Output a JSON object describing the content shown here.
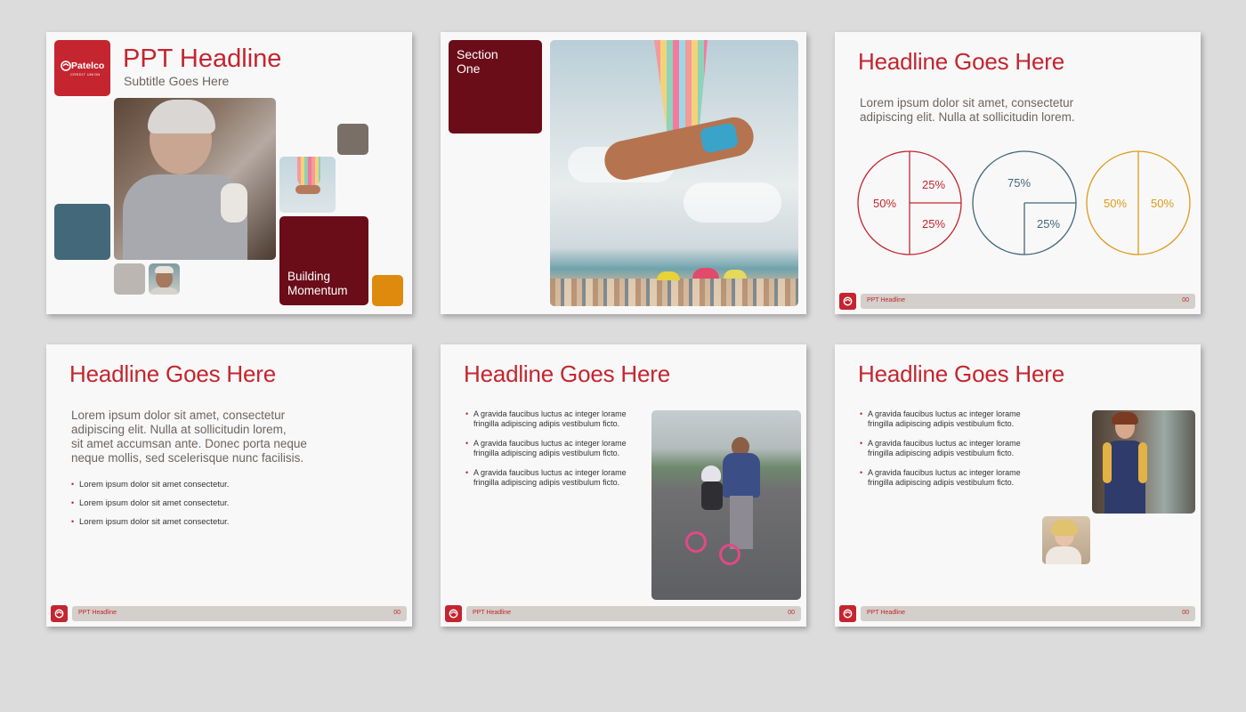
{
  "colors": {
    "brand_red": "#c4252f",
    "maroon": "#6a0d19",
    "slate_blue": "#42687a",
    "taupe": "#7a6f66",
    "light_gray": "#bbb6b1",
    "orange": "#dd8a0d",
    "footer_gray": "#d3cfca"
  },
  "slide1": {
    "logo_name": "Patelco",
    "logo_tagline": "CREDIT UNION",
    "title": "PPT Headline",
    "subtitle": "Subtitle Goes Here",
    "tile_text_1": "Building",
    "tile_text_2": "Momentum"
  },
  "slide2": {
    "section_line1": "Section",
    "section_line2": "One"
  },
  "slide3": {
    "headline": "Headline Goes Here",
    "body_line1": "Lorem ipsum dolor sit amet, consectetur",
    "body_line2": "adipiscing elit. Nulla at sollicitudin lorem.",
    "footer_label": "PPT Headline",
    "footer_page": "00"
  },
  "chart_data": {
    "type": "pie",
    "charts": [
      {
        "color": "#c4252f",
        "slices": [
          50,
          25,
          25
        ],
        "labels": [
          "50%",
          "25%",
          "25%"
        ]
      },
      {
        "color": "#42687a",
        "slices": [
          75,
          25
        ],
        "labels": [
          "75%",
          "25%"
        ]
      },
      {
        "color": "#dd9b1a",
        "slices": [
          50,
          50
        ],
        "labels": [
          "50%",
          "50%"
        ]
      }
    ]
  },
  "slide4": {
    "headline": "Headline Goes Here",
    "body_line1": "Lorem ipsum dolor sit amet, consectetur",
    "body_line2": "adipiscing elit. Nulla at sollicitudin lorem,",
    "body_line3": "sit amet accumsan ante. Donec porta neque",
    "body_line4": "neque mollis, sed scelerisque nunc facilisis.",
    "bullets": [
      "Lorem ipsum dolor sit amet consectetur.",
      "Lorem ipsum dolor sit amet consectetur.",
      "Lorem ipsum dolor sit amet consectetur."
    ],
    "footer_label": "PPT Headline",
    "footer_page": "00"
  },
  "slide5": {
    "headline": "Headline Goes Here",
    "bullets": [
      {
        "l1": "A gravida faucibus luctus ac integer lorame",
        "l2": "fringilla adipiscing adipis vestibulum ficto."
      },
      {
        "l1": "A gravida faucibus luctus ac integer lorame",
        "l2": "fringilla adipiscing adipis vestibulum ficto."
      },
      {
        "l1": "A gravida faucibus luctus ac integer lorame",
        "l2": "fringilla adipiscing adipis vestibulum ficto."
      }
    ],
    "footer_label": "PPT Headline",
    "footer_page": "00"
  },
  "slide6": {
    "headline": "Headline Goes Here",
    "bullets": [
      {
        "l1": "A gravida faucibus luctus ac integer lorame",
        "l2": "fringilla adipiscing adipis vestibulum ficto."
      },
      {
        "l1": "A gravida faucibus luctus ac integer lorame",
        "l2": "fringilla adipiscing adipis vestibulum ficto."
      },
      {
        "l1": "A gravida faucibus luctus ac integer lorame",
        "l2": "fringilla adipiscing adipis vestibulum ficto."
      }
    ],
    "footer_label": "PPT Headline",
    "footer_page": "00"
  }
}
